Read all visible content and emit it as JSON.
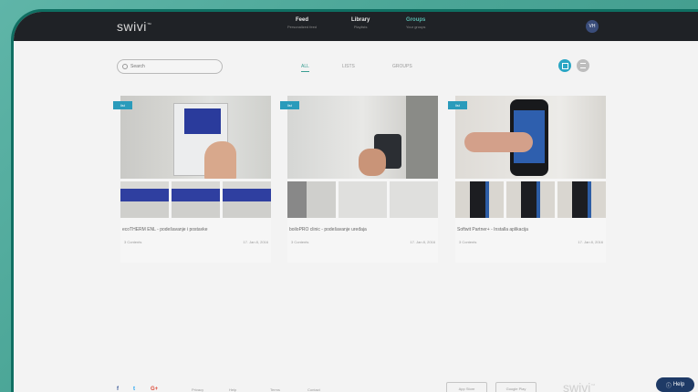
{
  "app": {
    "logo": "swivi",
    "logo_mark": "™"
  },
  "nav": [
    {
      "label": "Feed",
      "sub": "Personalized feed"
    },
    {
      "label": "Library",
      "sub": "Playlists"
    },
    {
      "label": "Groups",
      "sub": "Your groups"
    }
  ],
  "user": {
    "initials": "VH"
  },
  "search": {
    "placeholder": "Search"
  },
  "filters": [
    "ALL",
    "LISTS",
    "GROUPS"
  ],
  "cards": [
    {
      "tag": "list",
      "title": "ecoTHERM ENL - podešavanje i postavke",
      "meta_left": "3 Contents",
      "meta_right": "17. Jan 8, 2016"
    },
    {
      "tag": "list",
      "title": "boiloPRO clinic - podešavanje uređaja",
      "meta_left": "3 Contents",
      "meta_right": "17. Jan 8, 2016"
    },
    {
      "tag": "list",
      "title": "Softwit Partner+ - Installa aplikacija",
      "meta_left": "3 Contents",
      "meta_right": "17. Jan 8, 2016"
    }
  ],
  "footer": {
    "social": [
      "f",
      "t",
      "G+"
    ],
    "links": [
      "Privacy",
      "Help",
      "Terms",
      "Contact"
    ],
    "stores": [
      "App Store",
      "Google Play"
    ],
    "logo": "swivi",
    "help": "Help"
  },
  "colors": {
    "accent": "#3a9e92",
    "tag": "#2a9bbb",
    "topbar": "#1f2226"
  }
}
